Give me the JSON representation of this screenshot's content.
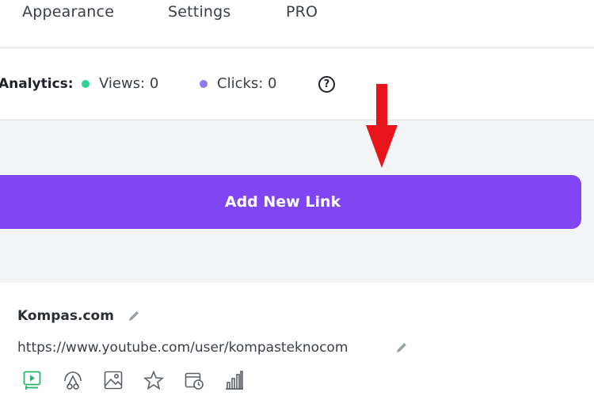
{
  "tabs": [
    {
      "label": "Appearance"
    },
    {
      "label": "Settings"
    },
    {
      "label": "PRO"
    }
  ],
  "analytics": {
    "label": "Analytics:",
    "views": "Views: 0",
    "clicks": "Clicks: 0",
    "help_icon": "question-circle-icon",
    "help_glyph": "?",
    "views_color": "#2fd391",
    "clicks_color": "#8a7cf0"
  },
  "annotation": {
    "arrow_icon": "red-arrow-down-icon",
    "color": "#e8141b"
  },
  "add_link": {
    "label": "Add New Link",
    "color": "#8046f4"
  },
  "link": {
    "title": "Kompas.com",
    "url": "https://www.youtube.com/user/kompasteknocom",
    "edit_icon": "pencil-icon",
    "tools": [
      {
        "icon": "video-embed-icon",
        "active": true
      },
      {
        "icon": "animation-icon",
        "active": false
      },
      {
        "icon": "thumbnail-image-icon",
        "active": false
      },
      {
        "icon": "star-icon",
        "active": false
      },
      {
        "icon": "schedule-clock-icon",
        "active": false
      },
      {
        "icon": "analytics-bars-icon",
        "active": false
      }
    ],
    "active_color": "#27b36b",
    "inactive_color": "#5b6068"
  }
}
